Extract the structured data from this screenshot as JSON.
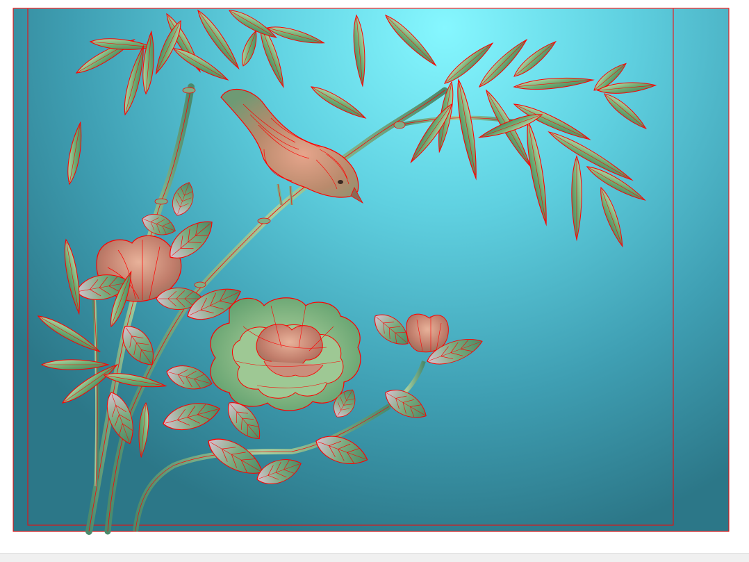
{
  "viewport": {
    "background": "#ffffff"
  },
  "relief": {
    "subject": "bird-on-bamboo-with-peony",
    "colors": {
      "background_light": "#7ff2ff",
      "background_mid": "#4fb8cc",
      "background_dark": "#2e7f93",
      "outline": "#ff0000",
      "leaf_green": "#6aa86a",
      "leaf_light": "#b9d9a8",
      "petal_pink": "#d08a7a",
      "stem_green": "#7fae86"
    }
  },
  "status_strip": {
    "background": "#f0f0f0"
  }
}
